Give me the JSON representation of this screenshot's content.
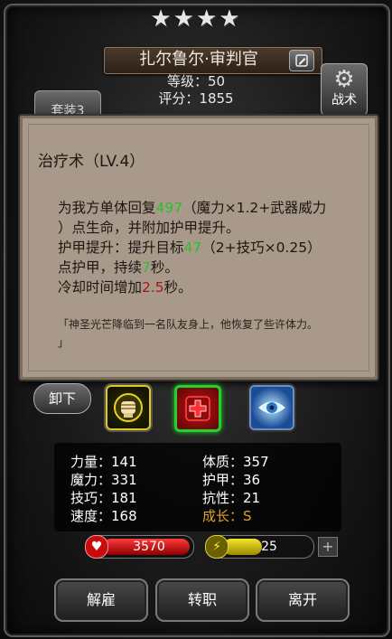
{
  "header": {
    "stars": "★★★★",
    "hero_name": "扎尔鲁尔·审判官",
    "level_text": "等级：50",
    "score_text": "评分：1855",
    "tab_set_label": "套装3",
    "tactics_label": "战术"
  },
  "tooltip": {
    "title": "治疗术（LV.4）",
    "desc": [
      {
        "pre": "为我方单体回复",
        "hl": "497",
        "post": "（魔力×1.2+武器威力"
      },
      {
        "pre": "）点生命，并附加护甲提升。",
        "hl": "",
        "post": ""
      },
      {
        "pre": "护甲提升：提升目标",
        "hl": "47",
        "post": "（2+技巧×0.25）"
      },
      {
        "pre": "点护甲，持续",
        "hl": "7",
        "post": "秒。"
      },
      {
        "pre": "冷却时间增加",
        "hl": "2.5",
        "post": "秒。"
      }
    ],
    "quote_1": "「神圣光芒降临到一名队友身上，他恢复了些许体力。",
    "quote_2": "」"
  },
  "skills": {
    "unequip_label": "卸下",
    "icons": [
      "fist-skill-icon",
      "heal-cross-skill-icon",
      "eye-skill-icon"
    ]
  },
  "stats": {
    "strength": "力量：141",
    "constitution": "体质：357",
    "magic": "魔力：331",
    "armor": "护甲：36",
    "skill": "技巧：181",
    "resist": "抗性：21",
    "speed": "速度：168",
    "growth": "成长：S"
  },
  "resources": {
    "hp": "3570",
    "hp_ratio": 0.83,
    "energy": "25",
    "energy_ratio": 0.45
  },
  "actions": {
    "dismiss": "解雇",
    "job_change": "转职",
    "leave": "离开"
  },
  "colors": {
    "highlight_green": "#2cc02c",
    "highlight_red": "#a41616",
    "growth_orange": "#e0a22b",
    "selected_skill_border": "#22d12a"
  }
}
